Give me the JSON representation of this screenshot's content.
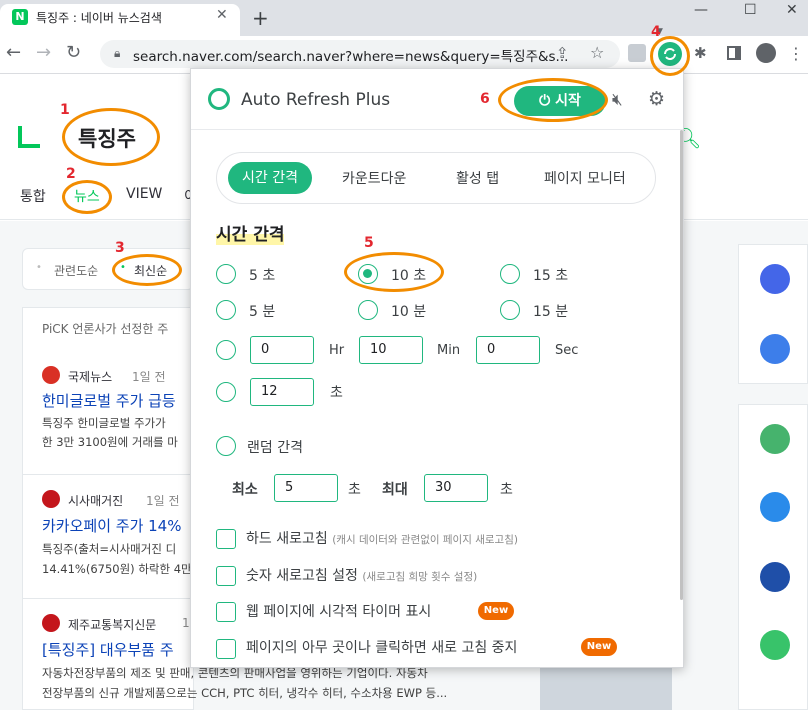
{
  "browser": {
    "tab_title": "특징주 : 네이버 뉴스검색",
    "new_tab": "+",
    "url": "search.naver.com/search.naver?where=news&query=특징주&s..."
  },
  "naver": {
    "query": "특징주",
    "tabs": [
      "통합",
      "뉴스",
      "VIEW",
      "이"
    ],
    "sort": [
      "관련도순",
      "최신순"
    ],
    "pick_header": "PiCK 언론사가 선정한 주",
    "articles": [
      {
        "press": "국제뉴스",
        "time": "1일 전",
        "title": "한미글로벌 주가 급등",
        "body1": "특징주 한미글로벌 주가가",
        "body2": "한 3만 3100원에 거래를 마"
      },
      {
        "press": "시사매거진",
        "time": "1일 전",
        "title": "카카오페이 주가 14%",
        "body1": "특징주(출처=시사매거진 디",
        "body2": "14.41%(6750원) 하락한 4만"
      },
      {
        "press": "제주교통복지신문",
        "time": "1",
        "title": "[특징주] 대우부품 주",
        "body1": "자동차전장부품의 제조 및 판매, 콘텐츠의 판매사업을 영위하는 기업이다. 자동차",
        "body2": "전장부품의 신규 개발제품으로는 CCH, PTC 히터, 냉각수 히터, 수소차용 EWP 등..."
      }
    ]
  },
  "popup": {
    "title": "Auto Refresh Plus",
    "start_label": "시작",
    "tabs": [
      "시간 간격",
      "카운트다운",
      "활성 탭",
      "페이지 모니터"
    ],
    "section_title": "시간 간격",
    "presets": [
      "5 초",
      "10 초",
      "15 초",
      "5 분",
      "10 분",
      "15 분"
    ],
    "selected_preset": "10 초",
    "custom": {
      "hr": "0",
      "min": "10",
      "sec": "0",
      "hr_label": "Hr",
      "min_label": "Min",
      "sec_label": "Sec"
    },
    "seconds_only": {
      "value": "12",
      "unit": "초"
    },
    "random": {
      "label": "랜덤 간격",
      "min_label": "최소",
      "min_value": "5",
      "max_label": "최대",
      "max_value": "30",
      "unit": "초"
    },
    "options": [
      {
        "label": "하드 새로고침",
        "sub": "(캐시 데이터와 관련없이 페이지 새로고침)",
        "badge": ""
      },
      {
        "label": "숫자 새로고침 설정",
        "sub": "(새로고침 희망 횟수 설정)",
        "badge": ""
      },
      {
        "label": "웹 페이지에 시각적 타이머 표시",
        "sub": "",
        "badge": "New"
      },
      {
        "label": "페이지의 아무 곳이나 클릭하면 새로 고침 중지",
        "sub": "",
        "badge": "New"
      }
    ]
  },
  "annotations": [
    "1",
    "2",
    "3",
    "4",
    "5",
    "6"
  ],
  "colors": {
    "accent": "#20b77f",
    "naver_green": "#03c75a",
    "annotation_ring": "#f28c00",
    "annotation_number": "#e3272f",
    "new_badge": "#f06a00"
  }
}
